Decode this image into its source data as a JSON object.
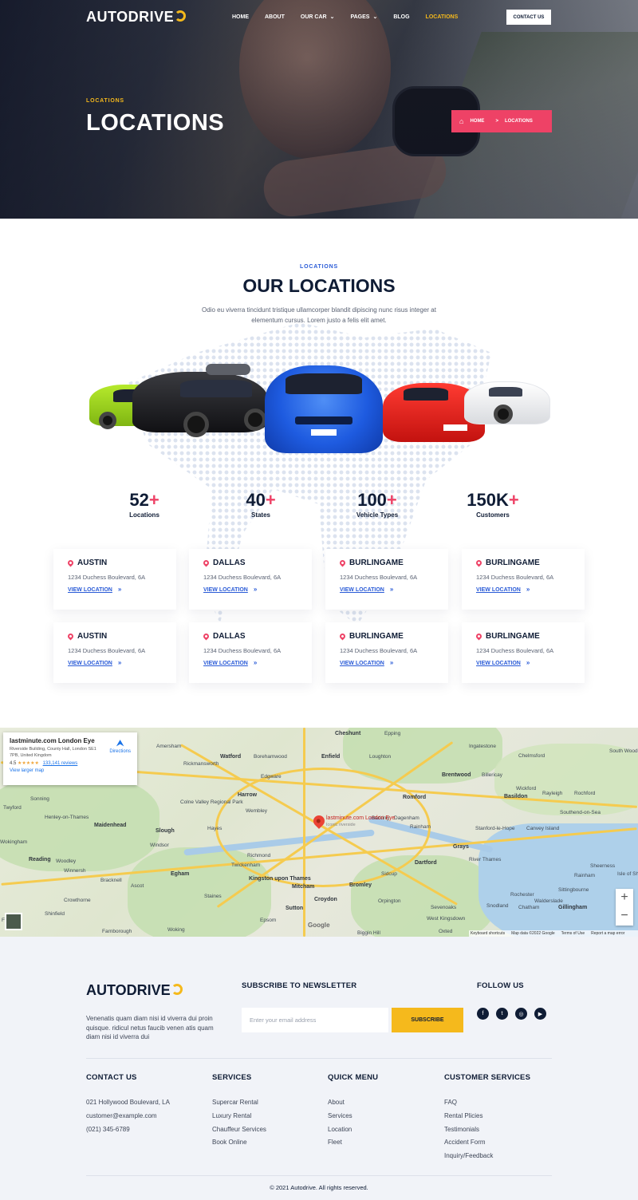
{
  "brand": {
    "name": "AUTODRIVE",
    "accent": "#f5b91c",
    "pink": "#ee4266",
    "navy": "#0f1c35",
    "blue": "#2a5bd7"
  },
  "nav": {
    "items": [
      {
        "label": "HOME"
      },
      {
        "label": "ABOUT"
      },
      {
        "label": "OUR CAR",
        "dropdown": true
      },
      {
        "label": "PAGES",
        "dropdown": true
      },
      {
        "label": "BLOG"
      },
      {
        "label": "LOCATIONS",
        "active": true
      }
    ],
    "contact_label": "CONTACT US"
  },
  "hero": {
    "kicker": "LOCATIONS",
    "title": "LOCATIONS",
    "breadcrumb": {
      "home": "HOME",
      "separator": ">",
      "current": "LOCATIONS",
      "home_icon": "home-icon"
    }
  },
  "locations_section": {
    "kicker": "LOCATIONS",
    "title": "OUR LOCATIONS",
    "description": "Odio eu viverra tincidunt tristique ullamcorper blandit dipiscing nunc risus integer at elementum cursus. Lorem justo a felis elit amet.",
    "stats": [
      {
        "value": "52",
        "suffix": "+",
        "label": "Locations"
      },
      {
        "value": "40",
        "suffix": "+",
        "label": "States"
      },
      {
        "value": "100",
        "suffix": "+",
        "label": "Vehicle Types"
      },
      {
        "value": "150K",
        "suffix": "+",
        "label": "Customers"
      }
    ],
    "cards": [
      {
        "city": "AUSTIN",
        "address": "1234 Duchess Boulevard, 6A",
        "link": "VIEW LOCATION"
      },
      {
        "city": "DALLAS",
        "address": "1234 Duchess Boulevard, 6A",
        "link": "VIEW LOCATION"
      },
      {
        "city": "BURLINGAME",
        "address": "1234 Duchess Boulevard, 6A",
        "link": "VIEW LOCATION"
      },
      {
        "city": "BURLINGAME",
        "address": "1234 Duchess Boulevard, 6A",
        "link": "VIEW LOCATION"
      },
      {
        "city": "AUSTIN",
        "address": "1234 Duchess Boulevard, 6A",
        "link": "VIEW LOCATION"
      },
      {
        "city": "DALLAS",
        "address": "1234 Duchess Boulevard, 6A",
        "link": "VIEW LOCATION"
      },
      {
        "city": "BURLINGAME",
        "address": "1234 Duchess Boulevard, 6A",
        "link": "VIEW LOCATION"
      },
      {
        "city": "BURLINGAME",
        "address": "1234 Duchess Boulevard, 6A",
        "link": "VIEW LOCATION"
      }
    ],
    "car_colors": [
      "#9ad41c",
      "#1b1b1f",
      "#1e5be0",
      "#e0221f",
      "#f2f2f2"
    ]
  },
  "map": {
    "place_card": {
      "title": "lastminute.com London Eye",
      "address": "Riverside Building, County Hall, London SE1 7PB, United Kingdom",
      "rating": "4.5",
      "stars": "★★★★★",
      "reviews": "133,141 reviews",
      "larger_map": "View larger map",
      "directions": "Directions"
    },
    "pin_label": "lastminute.com London Eye",
    "pin_sub": "Iconic riverside",
    "labels": [
      "Cheshunt",
      "Epping",
      "Watford",
      "Borehamwood",
      "Enfield",
      "Loughton",
      "Brentwood",
      "Billericay",
      "Wickford",
      "Rayleigh",
      "Rochford",
      "Southend-on-Sea",
      "Basildon",
      "Romford",
      "Edgware",
      "Harrow",
      "Wembley",
      "Colne Valley Regional Park",
      "Maidenhead",
      "Slough",
      "Hayes",
      "Windsor",
      "Reading",
      "Woodley",
      "Bracknell",
      "Ascot",
      "Egham",
      "Richmond",
      "Twickenham",
      "Kingston upon Thames",
      "Mitcham",
      "Croydon",
      "Bromley",
      "Sidcup",
      "Dartford",
      "Grays",
      "Rainham",
      "Dagenham",
      "Barking",
      "Canvey Island",
      "Rochester",
      "Chatham",
      "Gillingham",
      "Sutton",
      "Epsom",
      "Woking",
      "Farnborough",
      "Orpington",
      "Sevenoaks",
      "Biggin Hill",
      "Oxted",
      "Sheerness",
      "Isle of Sheppey",
      "Wokingham",
      "Henley-on-Thames",
      "Twyford",
      "Rickmansworth",
      "Amersham",
      "Ingatestone",
      "Chelmsford",
      "South Woodham Ferrers",
      "Stanford-le-Hope",
      "River Thames",
      "West Kingsdown",
      "Snodland",
      "Sittingbourne",
      "Rainham",
      "Walderslade",
      "Fleet",
      "Crowthorne",
      "Staines",
      "Winnersh",
      "Sonning",
      "Shinfield"
    ],
    "google": "Google",
    "attribution": [
      "Keyboard shortcuts",
      "Map data ©2022 Google",
      "Terms of Use",
      "Report a map error"
    ],
    "zoom_in": "+",
    "zoom_out": "−"
  },
  "footer": {
    "description": "Venenatis quam diam nisi id viverra dui proin quisque. ridicul netus faucib venen atis quam diam nisi id viverra dui",
    "newsletter": {
      "title": "SUBSCRIBE TO NEWSLETTER",
      "placeholder": "Enter your email address",
      "button": "SUBSCRIBE"
    },
    "follow": {
      "title": "FOLLOW US",
      "icons": [
        "facebook-icon",
        "twitter-icon",
        "instagram-icon",
        "youtube-icon"
      ]
    },
    "columns": [
      {
        "title": "CONTACT US",
        "items": [
          "021 Hollywood Boulevard, LA",
          "customer@example.com",
          "(021) 345-6789"
        ]
      },
      {
        "title": "SERVICES",
        "items": [
          "Supercar Rental",
          "Luxury Rental",
          "Chauffeur Services",
          "Book Online"
        ]
      },
      {
        "title": "QUICK MENU",
        "items": [
          "About",
          "Services",
          "Location",
          "Fleet"
        ]
      },
      {
        "title": "CUSTOMER SERVICES",
        "items": [
          "FAQ",
          "Rental Plicies",
          "Testimonials",
          "Accident Form",
          "Inquiry/Feedback"
        ]
      }
    ],
    "copyright": "© 2021 Autodrive. All rights reserved."
  }
}
